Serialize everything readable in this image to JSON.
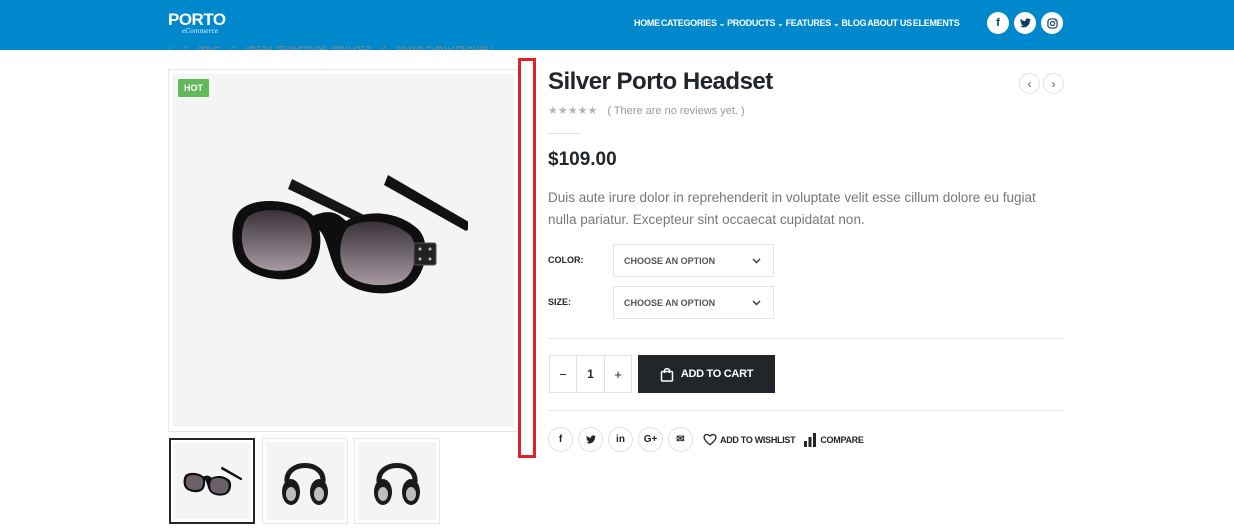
{
  "header": {
    "logo_text": "PORTO",
    "logo_sub": "eCommerce",
    "nav": [
      {
        "label": "HOME",
        "caret": false
      },
      {
        "label": "CATEGORIES",
        "caret": true
      },
      {
        "label": "PRODUCTS",
        "caret": true
      },
      {
        "label": "FEATURES",
        "caret": true
      },
      {
        "label": "BLOG",
        "caret": false
      },
      {
        "label": "ABOUT US",
        "caret": false
      },
      {
        "label": "ELEMENTS",
        "caret": false
      }
    ],
    "caret_glyph": "⌄",
    "social": {
      "facebook": "f",
      "twitter": "t",
      "instagram": "◎"
    }
  },
  "breadcrumb": {
    "home_icon": "⌂",
    "sep": ">",
    "items": [
      "SHOP",
      "DRESS, HEADPHONE, WATCHES",
      "SILVER PORTO HEADSET"
    ]
  },
  "gallery": {
    "badge": "HOT",
    "main_image": "sunglasses",
    "thumbs": [
      "sunglasses",
      "headphones",
      "headphones"
    ]
  },
  "product": {
    "title": "Silver Porto Headset",
    "stars": "★★★★★",
    "reviews": "( There are no reviews yet. )",
    "price": "$109.00",
    "description": "Duis aute irure dolor in reprehenderit in voluptate velit esse cillum dolore eu fugiat nulla pariatur. Excepteur sint occaecat cupidatat non.",
    "prev_icon": "‹",
    "next_icon": "›"
  },
  "options": {
    "color_label": "COLOR:",
    "color_value": "CHOOSE AN OPTION",
    "size_label": "SIZE:",
    "size_value": "CHOOSE AN OPTION"
  },
  "cart": {
    "minus": "−",
    "quantity": "1",
    "plus": "+",
    "add_label": "ADD TO CART"
  },
  "share": {
    "facebook": "f",
    "twitter": "t",
    "linkedin": "in",
    "google": "G+",
    "email": "✉",
    "wishlist_label": "ADD TO WISHLIST",
    "compare_label": "COMPARE"
  },
  "colors": {
    "brand": "#0088cc",
    "dark": "#222529",
    "hot": "#62b959",
    "highlight": "#e0202a"
  }
}
